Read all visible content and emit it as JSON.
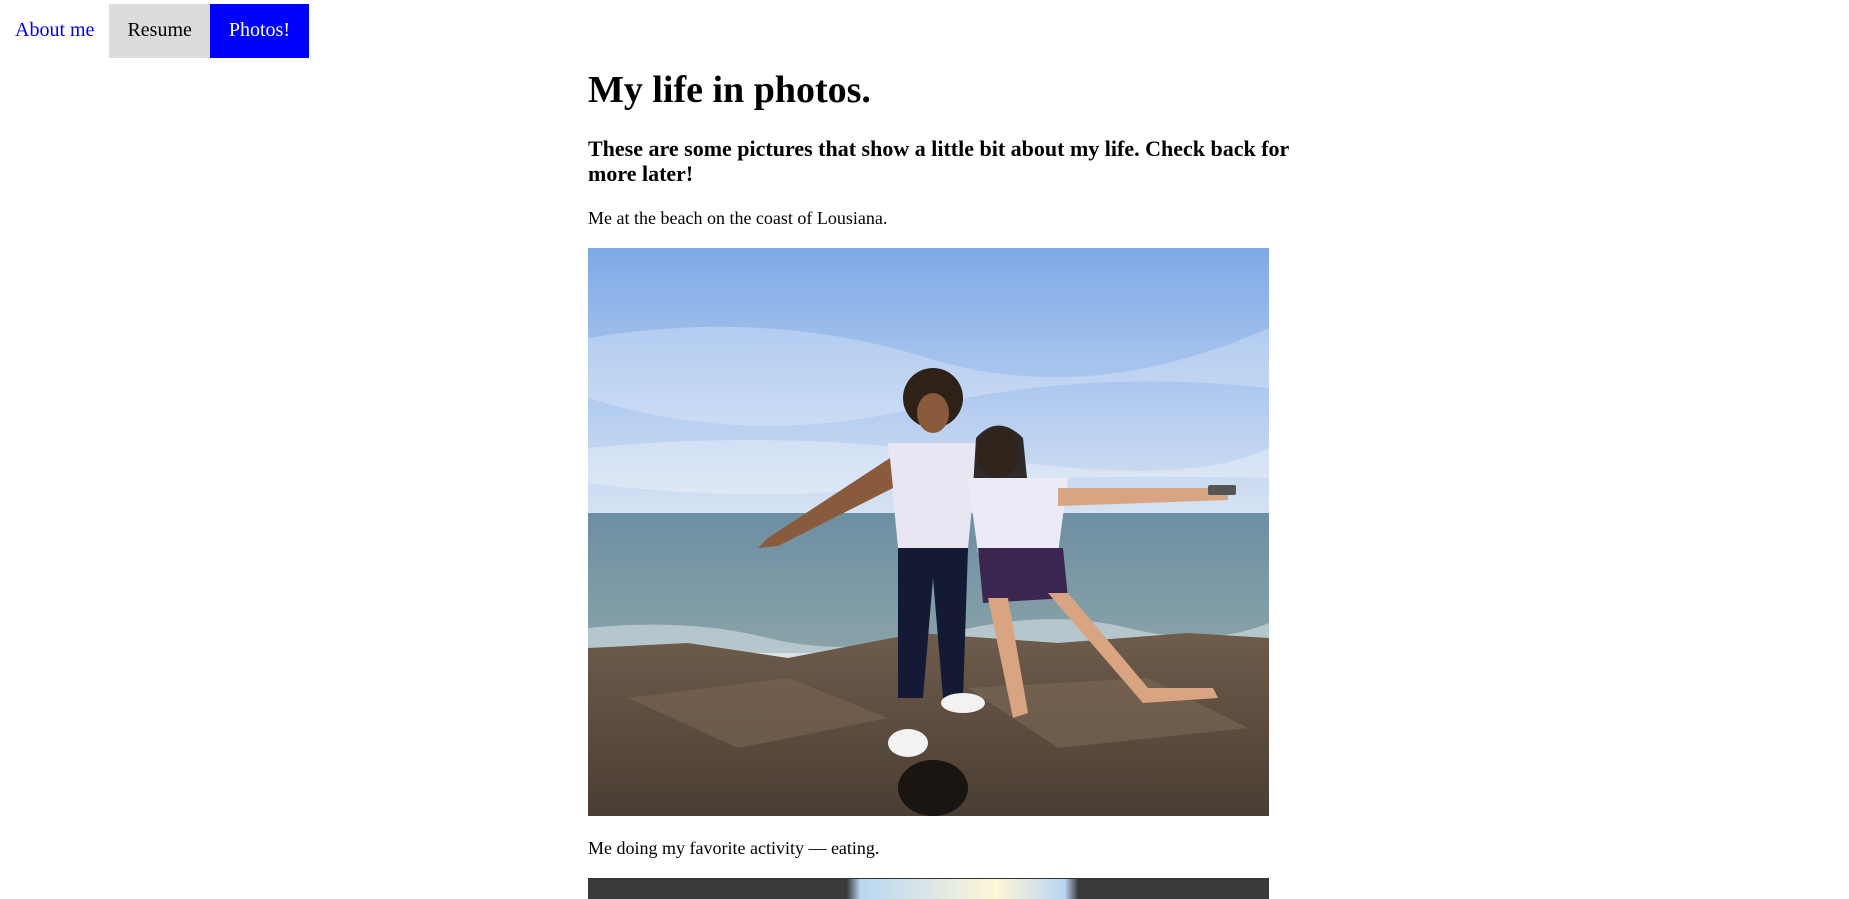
{
  "nav": {
    "about": "About me",
    "resume": "Resume",
    "photos": "Photos!"
  },
  "page": {
    "title": "My life in photos.",
    "subtitle": "These are some pictures that show a little bit about my life. Check back for more later!",
    "captions": [
      "Me at the beach on the coast of Lousiana.",
      "Me doing my favorite activity — eating."
    ]
  },
  "colors": {
    "active_tab": "#0000ff",
    "resume_tab": "#dcdcdc",
    "link": "#0000ee"
  }
}
